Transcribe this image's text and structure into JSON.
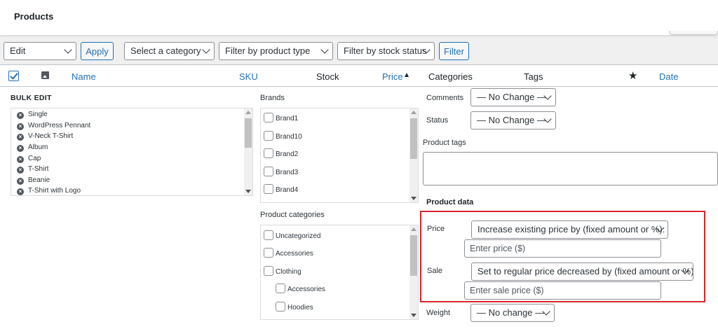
{
  "header": {
    "title": "Products"
  },
  "toolbar": {
    "bulk_action": "Edit",
    "apply": "Apply",
    "category_filter": "Select a category",
    "type_filter": "Filter by product type",
    "stock_filter": "Filter by stock status",
    "filter": "Filter"
  },
  "table_header": {
    "name": "Name",
    "sku": "SKU",
    "stock": "Stock",
    "price": "Price",
    "categories": "Categories",
    "tags": "Tags",
    "date": "Date"
  },
  "bulk_edit": {
    "title": "BULK EDIT",
    "items": [
      "Single",
      "WordPress Pennant",
      "V-Neck T-Shirt",
      "Album",
      "Cap",
      "T-Shirt",
      "Beanie",
      "T-Shirt with Logo"
    ]
  },
  "brands": {
    "label": "Brands",
    "items": [
      "Brand1",
      "Brand10",
      "Brand2",
      "Brand3",
      "Brand4"
    ]
  },
  "product_categories": {
    "label": "Product categories",
    "items": [
      "Uncategorized",
      "Accessories",
      "Clothing",
      "Accessories",
      "Hoodies"
    ]
  },
  "fields": {
    "comments_label": "Comments",
    "comments_value": "— No Change —",
    "status_label": "Status",
    "status_value": "— No Change —",
    "product_tags_label": "Product tags"
  },
  "product_data": {
    "title": "Product data",
    "price_label": "Price",
    "price_select": "Increase existing price by (fixed amount or %):",
    "price_placeholder": "Enter price ($)",
    "sale_label": "Sale",
    "sale_select": "Set to regular price decreased by (fixed amount or %):",
    "sale_placeholder": "Enter sale price ($)",
    "weight_label": "Weight",
    "weight_value": "— No change —"
  },
  "colors": {
    "accent": "#2271b1",
    "highlight": "#d9252b"
  }
}
